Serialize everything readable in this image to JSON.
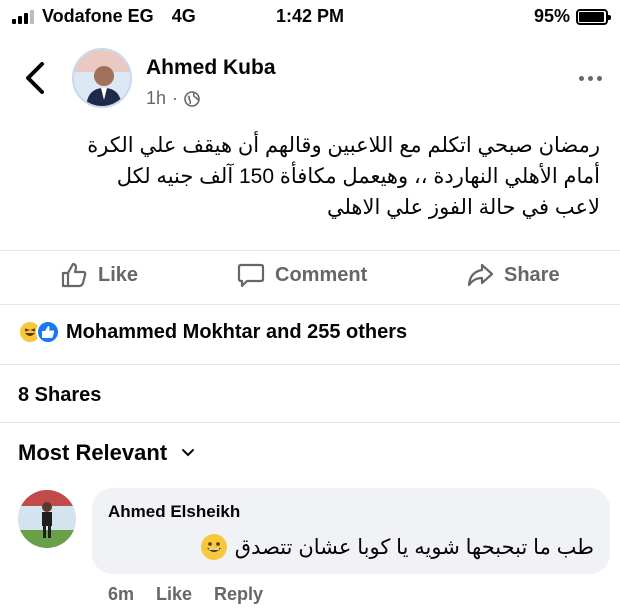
{
  "status_bar": {
    "carrier": "Vodafone EG",
    "network": "4G",
    "time": "1:42 PM",
    "battery": "95%",
    "battery_level": 0.95
  },
  "post": {
    "author": "Ahmed Kuba",
    "time_ago": "1h",
    "separator": "·",
    "text_lines": [
      "رمضان صبحي اتكلم مع اللاعبين وقالهم أن هيقف علي الكرة",
      "أمام الأهلي النهاردة ،، وهيعمل مكافأة 150 آلف جنيه لكل",
      "لاعب في حالة الفوز علي الاهلي"
    ]
  },
  "actions": {
    "like": "Like",
    "comment": "Comment",
    "share": "Share"
  },
  "reactions": {
    "summary": "Mohammed Mokhtar and 255 others"
  },
  "shares": "8 Shares",
  "comments_sort": "Most Relevant",
  "comment": {
    "author": "Ahmed Elsheikh",
    "text": "طب ما تبحبحها شويه يا كوبا عشان تتصدق",
    "time_ago": "6m",
    "like": "Like",
    "reply": "Reply"
  },
  "colors": {
    "secondary_text": "#65676b",
    "like_blue": "#1877f2",
    "bubble_bg": "#f0f2f5"
  }
}
